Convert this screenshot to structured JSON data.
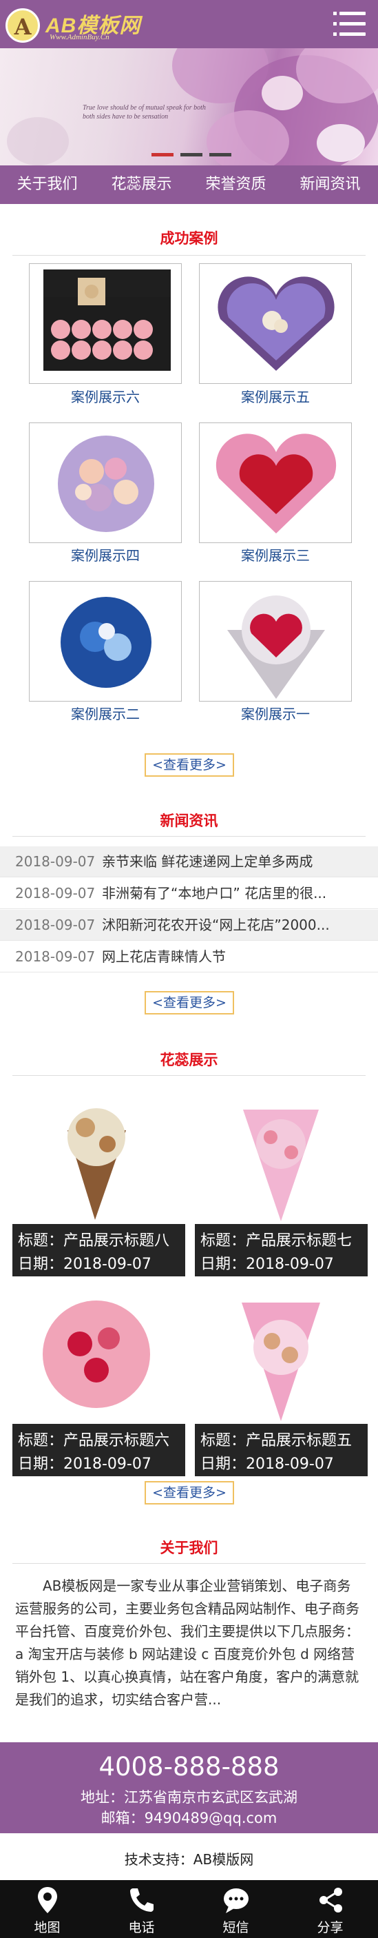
{
  "header": {
    "logo_letter": "A",
    "logo_text": "AB模板网",
    "logo_sub": "Www.AdminBuy.Cn"
  },
  "banner": {
    "quote": "True love should be of mutual speak for both both sides have to be sensation"
  },
  "nav": [
    "关于我们",
    "花蕊展示",
    "荣誉资质",
    "新闻资讯"
  ],
  "cases": {
    "title": "成功案例",
    "items": [
      "案例展示六",
      "案例展示五",
      "案例展示四",
      "案例展示三",
      "案例展示二",
      "案例展示一"
    ],
    "more": "查看更多"
  },
  "news": {
    "title": "新闻资讯",
    "items": [
      {
        "date": "2018-09-07",
        "text": "亲节来临 鲜花速递网上定单多两成"
      },
      {
        "date": "2018-09-07",
        "text": "非洲菊有了“本地户口” 花店里的很..."
      },
      {
        "date": "2018-09-07",
        "text": "沭阳新河花农开设“网上花店”2000..."
      },
      {
        "date": "2018-09-07",
        "text": "网上花店青睐情人节"
      }
    ],
    "more": "查看更多"
  },
  "products": {
    "title": "花蕊展示",
    "items": [
      {
        "title": "标题：产品展示标题八",
        "date": "日期：2018-09-07"
      },
      {
        "title": "标题：产品展示标题七",
        "date": "日期：2018-09-07"
      },
      {
        "title": "标题：产品展示标题六",
        "date": "日期：2018-09-07"
      },
      {
        "title": "标题：产品展示标题五",
        "date": "日期：2018-09-07"
      }
    ],
    "more": "查看更多"
  },
  "about": {
    "title": "关于我们",
    "text": "AB模板网是一家专业从事企业营销策划、电子商务运营服务的公司，主要业务包含精品网站制作、电子商务平台托管、百度竞价外包、我们主要提供以下几点服务： a 淘宝开店与装修 b 网站建设 c 百度竞价外包 d 网络营销外包 1、以真心换真情，站在客户角度，客户的满意就是我们的追求，切实结合客户营..."
  },
  "footer": {
    "phone": "4008-888-888",
    "address": "地址：江苏省南京市玄武区玄武湖",
    "email": "邮箱：9490489@qq.com",
    "support": "技术支持：AB模版网"
  },
  "bottombar": [
    {
      "label": "地图",
      "icon": "map-pin-icon"
    },
    {
      "label": "电话",
      "icon": "phone-icon"
    },
    {
      "label": "短信",
      "icon": "sms-icon"
    },
    {
      "label": "分享",
      "icon": "share-icon"
    }
  ],
  "colors": {
    "brand": "#8e5a97",
    "title_red": "#e1141e",
    "link_blue": "#204d90"
  }
}
